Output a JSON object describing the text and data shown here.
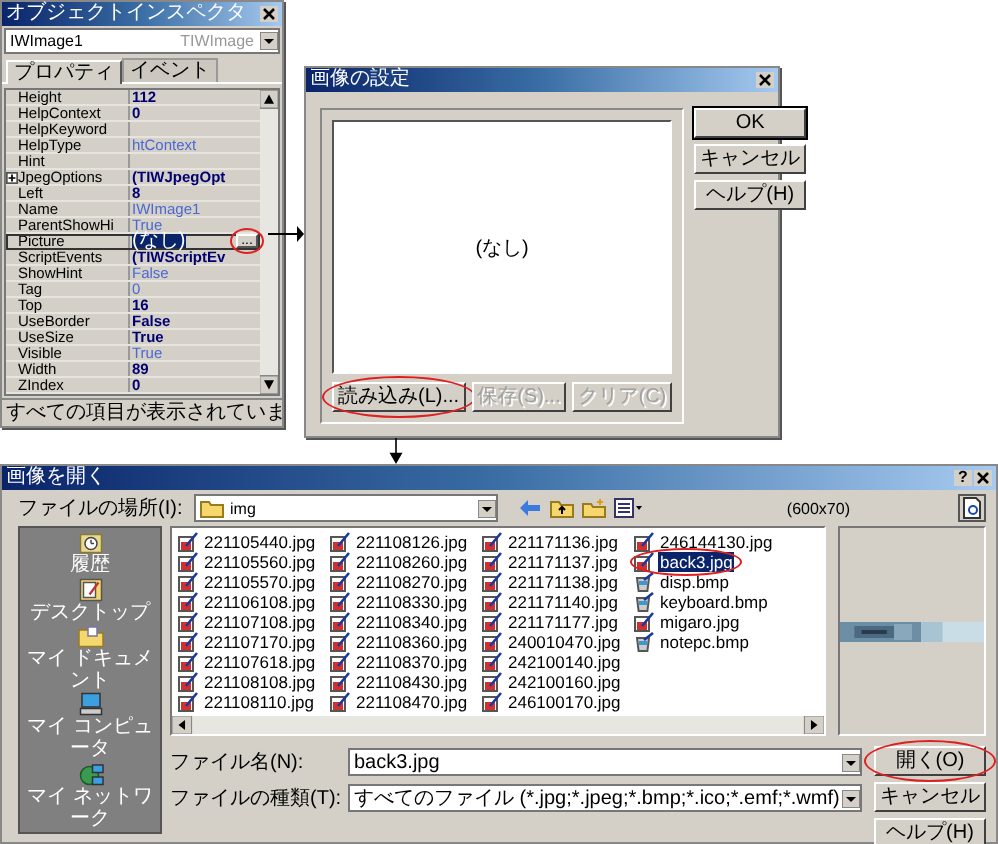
{
  "inspector": {
    "title": "オブジェクトインスペクタ",
    "object_name": "IWImage1",
    "object_type": "TIWImage",
    "tabs": [
      {
        "label": "プロパティ",
        "selected": true
      },
      {
        "label": "イベント",
        "selected": false
      }
    ],
    "properties": [
      {
        "name": "Height",
        "value": "112",
        "bold": true,
        "selected": false
      },
      {
        "name": "HelpContext",
        "value": "0",
        "bold": true,
        "selected": false
      },
      {
        "name": "HelpKeyword",
        "selected": false
      },
      {
        "name": "HelpType",
        "value": "htContext",
        "bold": false,
        "selected": false
      },
      {
        "name": "Hint",
        "selected": false
      },
      {
        "name": "JpegOptions",
        "value": "(TIWJpegOpt",
        "bold": true,
        "selected": false,
        "expandable": true
      },
      {
        "name": "Left",
        "value": "8",
        "bold": true,
        "selected": false
      },
      {
        "name": "Name",
        "value": "IWImage1",
        "bold": false,
        "selected": false
      },
      {
        "name": "ParentShowHi",
        "value": "True",
        "bold": false,
        "selected": false
      },
      {
        "name": "Picture",
        "value": "(なし)",
        "bold": false,
        "selected": true,
        "button": {
          "label": "...",
          "highlighted": true
        }
      },
      {
        "name": "ScriptEvents",
        "value": "(TIWScriptEv",
        "bold": true,
        "selected": false
      },
      {
        "name": "ShowHint",
        "value": "False",
        "bold": false,
        "selected": false
      },
      {
        "name": "Tag",
        "value": "0",
        "bold": false,
        "selected": false
      },
      {
        "name": "Top",
        "value": "16",
        "bold": true,
        "selected": false
      },
      {
        "name": "UseBorder",
        "value": "False",
        "bold": true,
        "selected": false
      },
      {
        "name": "UseSize",
        "value": "True",
        "bold": true,
        "selected": false
      },
      {
        "name": "Visible",
        "value": "True",
        "bold": false,
        "selected": false
      },
      {
        "name": "Width",
        "value": "89",
        "bold": true,
        "selected": false
      },
      {
        "name": "ZIndex",
        "value": "0",
        "bold": true,
        "selected": false
      }
    ],
    "status": "すべての項目が表示されていま"
  },
  "picture_dialog": {
    "title": "画像の設定",
    "preview_text": "(なし)",
    "buttons": [
      {
        "label": "読み込み(L)...",
        "disabled": false,
        "highlighted": true
      },
      {
        "label": "保存(S)...",
        "disabled": true,
        "highlighted": false
      },
      {
        "label": "クリア(C)",
        "disabled": true,
        "highlighted": false
      }
    ],
    "side_buttons": [
      {
        "label": "OK",
        "default": true
      },
      {
        "label": "キャンセル",
        "default": false
      },
      {
        "label": "ヘルプ(H)",
        "default": false
      }
    ]
  },
  "open_dialog": {
    "title": "画像を開く",
    "help_glyph": "?",
    "location_label": "ファイルの場所(I):",
    "location": "img",
    "preview_size": "(600x70)",
    "places": [
      {
        "label": "履歴",
        "kind": "history"
      },
      {
        "label": "デスクトップ",
        "kind": "desktop"
      },
      {
        "label": "マイ ドキュメント",
        "kind": "documents"
      },
      {
        "label": "マイ コンピュータ",
        "kind": "computer"
      },
      {
        "label": "マイ ネットワーク",
        "kind": "network"
      }
    ],
    "files": [
      {
        "name": "221105440.jpg",
        "kind": "jpg",
        "selected": false,
        "highlighted": false
      },
      {
        "name": "221105560.jpg",
        "kind": "jpg",
        "selected": false,
        "highlighted": false
      },
      {
        "name": "221105570.jpg",
        "kind": "jpg",
        "selected": false,
        "highlighted": false
      },
      {
        "name": "221106108.jpg",
        "kind": "jpg",
        "selected": false,
        "highlighted": false
      },
      {
        "name": "221107108.jpg",
        "kind": "jpg",
        "selected": false,
        "highlighted": false
      },
      {
        "name": "221107170.jpg",
        "kind": "jpg",
        "selected": false,
        "highlighted": false
      },
      {
        "name": "221107618.jpg",
        "kind": "jpg",
        "selected": false,
        "highlighted": false
      },
      {
        "name": "221108108.jpg",
        "kind": "jpg",
        "selected": false,
        "highlighted": false
      },
      {
        "name": "221108110.jpg",
        "kind": "jpg",
        "selected": false,
        "highlighted": false
      },
      {
        "name": "221108126.jpg",
        "kind": "jpg",
        "selected": false,
        "highlighted": false
      },
      {
        "name": "221108260.jpg",
        "kind": "jpg",
        "selected": false,
        "highlighted": false
      },
      {
        "name": "221108270.jpg",
        "kind": "jpg",
        "selected": false,
        "highlighted": false
      },
      {
        "name": "221108330.jpg",
        "kind": "jpg",
        "selected": false,
        "highlighted": false
      },
      {
        "name": "221108340.jpg",
        "kind": "jpg",
        "selected": false,
        "highlighted": false
      },
      {
        "name": "221108360.jpg",
        "kind": "jpg",
        "selected": false,
        "highlighted": false
      },
      {
        "name": "221108370.jpg",
        "kind": "jpg",
        "selected": false,
        "highlighted": false
      },
      {
        "name": "221108430.jpg",
        "kind": "jpg",
        "selected": false,
        "highlighted": false
      },
      {
        "name": "221108470.jpg",
        "kind": "jpg",
        "selected": false,
        "highlighted": false
      },
      {
        "name": "221171136.jpg",
        "kind": "jpg",
        "selected": false,
        "highlighted": false
      },
      {
        "name": "221171137.jpg",
        "kind": "jpg",
        "selected": false,
        "highlighted": false
      },
      {
        "name": "221171138.jpg",
        "kind": "jpg",
        "selected": false,
        "highlighted": false
      },
      {
        "name": "221171140.jpg",
        "kind": "jpg",
        "selected": false,
        "highlighted": false
      },
      {
        "name": "221171177.jpg",
        "kind": "jpg",
        "selected": false,
        "highlighted": false
      },
      {
        "name": "240010470.jpg",
        "kind": "jpg",
        "selected": false,
        "highlighted": false
      },
      {
        "name": "242100140.jpg",
        "kind": "jpg",
        "selected": false,
        "highlighted": false
      },
      {
        "name": "242100160.jpg",
        "kind": "jpg",
        "selected": false,
        "highlighted": false
      },
      {
        "name": "246100170.jpg",
        "kind": "jpg",
        "selected": false,
        "highlighted": false
      },
      {
        "name": "246144130.jpg",
        "kind": "jpg",
        "selected": false,
        "highlighted": false
      },
      {
        "name": "back3.jpg",
        "kind": "jpg",
        "selected": true,
        "highlighted": true
      },
      {
        "name": "disp.bmp",
        "kind": "bmp",
        "selected": false,
        "highlighted": false
      },
      {
        "name": "keyboard.bmp",
        "kind": "bmp",
        "selected": false,
        "highlighted": false
      },
      {
        "name": "migaro.jpg",
        "kind": "jpg",
        "selected": false,
        "highlighted": false
      },
      {
        "name": "notepc.bmp",
        "kind": "bmp",
        "selected": false,
        "highlighted": false
      }
    ],
    "file_name_label": "ファイル名(N):",
    "file_name": "back3.jpg",
    "file_type_label": "ファイルの種類(T):",
    "file_type": "すべてのファイル (*.jpg;*.jpeg;*.bmp;*.ico;*.emf;*.wmf)",
    "buttons": [
      {
        "label": "開く(O)",
        "highlighted": true
      },
      {
        "label": "キャンセル",
        "highlighted": false
      },
      {
        "label": "ヘルプ(H)",
        "highlighted": false
      }
    ]
  }
}
